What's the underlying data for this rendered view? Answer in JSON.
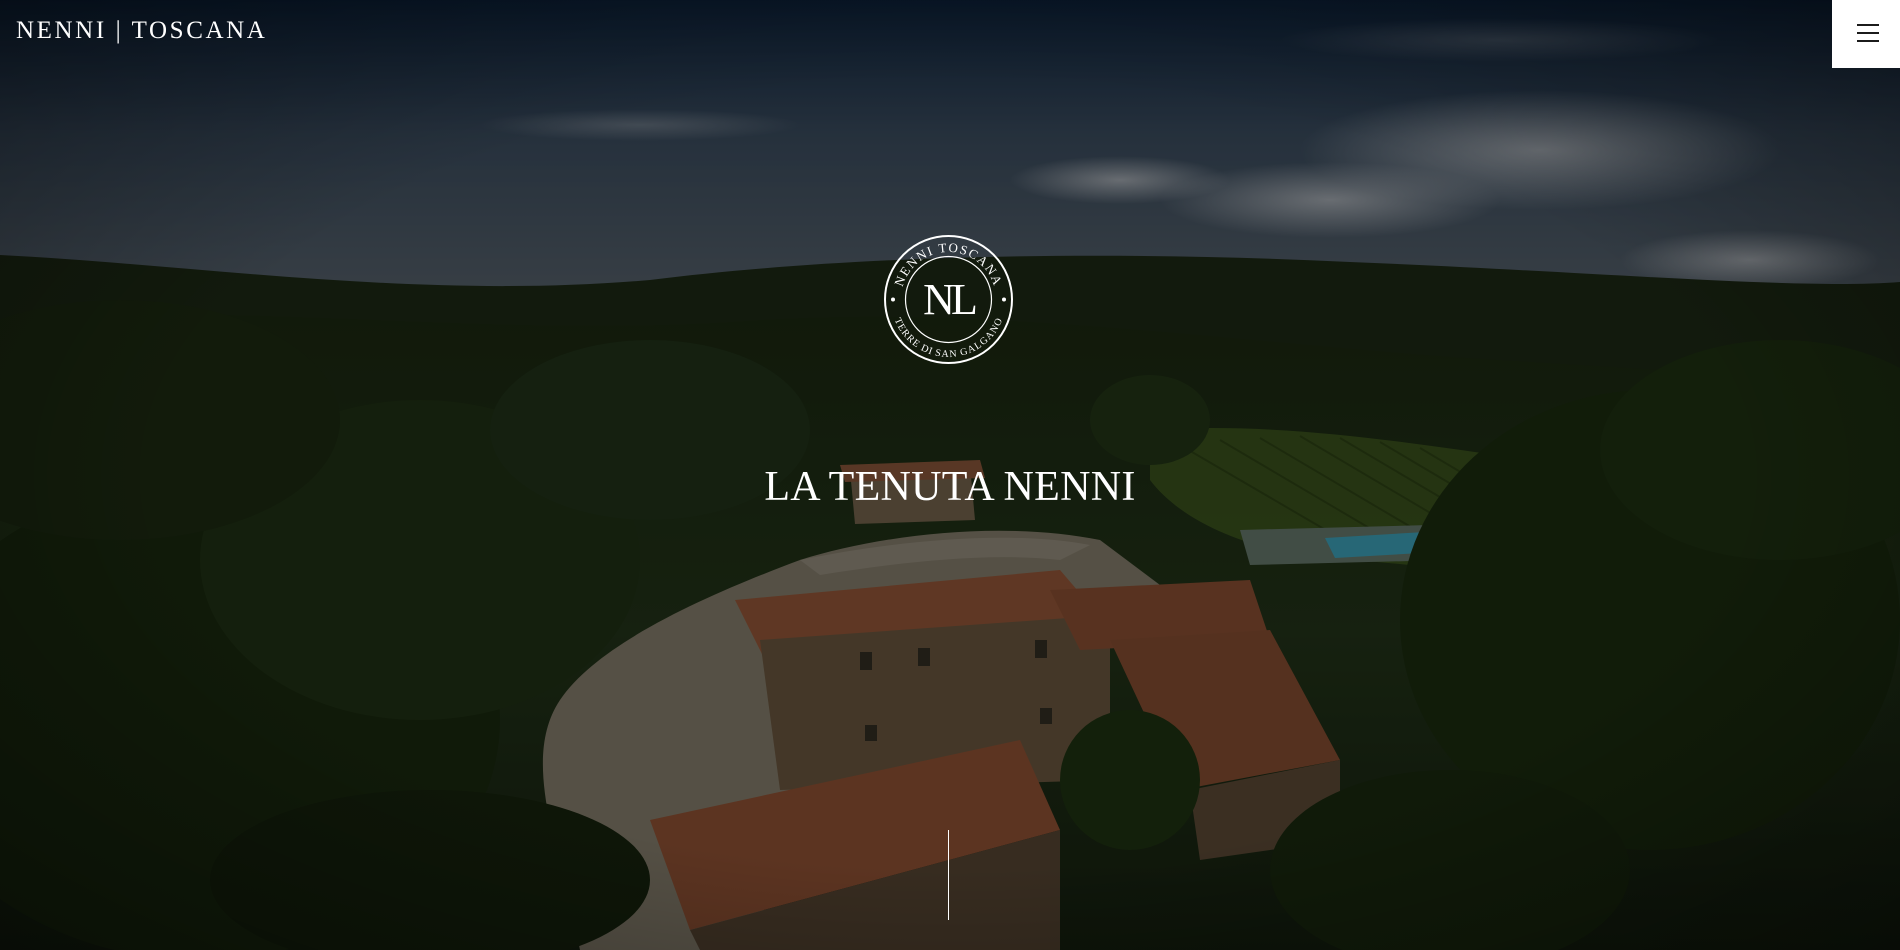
{
  "header": {
    "site_title": "NENNI | TOSCANA",
    "menu_icon": "hamburger-menu-icon"
  },
  "emblem": {
    "monogram": "NL",
    "ring_text_top": "NENNI TOSCANA",
    "ring_text_bottom": "TERRE DI SAN GALGANO"
  },
  "hero": {
    "heading": "LA TENUTA NENNI",
    "background": "aerial-view-tuscan-estate-image",
    "scroll_indicator": "scroll-down-line"
  },
  "colors": {
    "text": "#ffffff",
    "menu_button_bg": "#ffffff",
    "menu_icon": "#1b1b1b",
    "overlay": "#000000"
  }
}
